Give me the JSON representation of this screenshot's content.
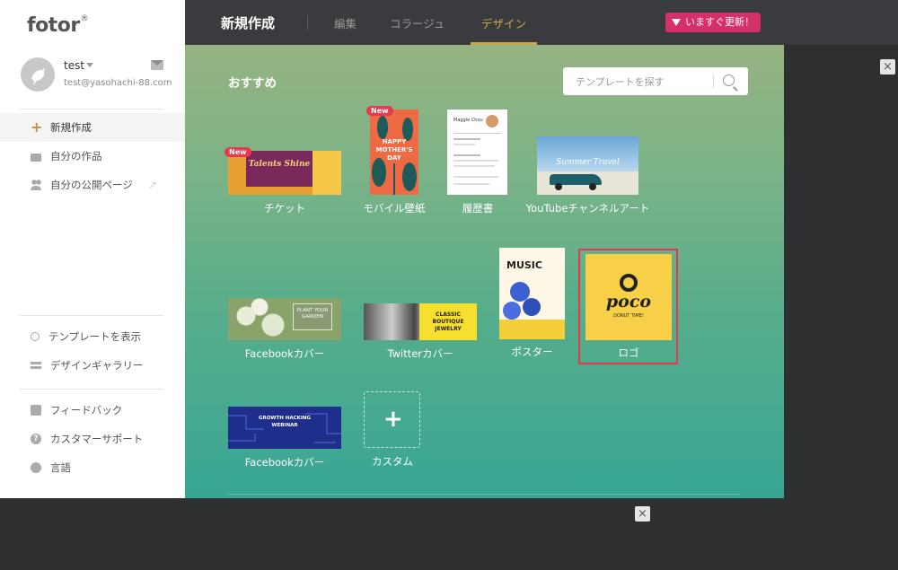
{
  "app": {
    "logo": "fotor"
  },
  "user": {
    "name": "test",
    "email": "test@yasohachi-88.com"
  },
  "sidebar": {
    "main_items": [
      {
        "label": "新規作成",
        "icon": "plus-icon"
      },
      {
        "label": "自分の作品",
        "icon": "folder-icon"
      },
      {
        "label": "自分の公開ページ",
        "icon": "people-icon"
      }
    ],
    "help_items": [
      {
        "label": "テンプレートを表示",
        "icon": "search-icon"
      },
      {
        "label": "デザインギャラリー",
        "icon": "layers-icon"
      }
    ],
    "support_items": [
      {
        "label": "フィードバック",
        "icon": "edit-icon"
      },
      {
        "label": "カスタマーサポート",
        "icon": "help-icon"
      },
      {
        "label": "言語",
        "icon": "globe-icon"
      }
    ]
  },
  "topbar": {
    "title": "新規作成",
    "tabs": [
      "編集",
      "コラージュ",
      "デザイン"
    ],
    "active_tab": "デザイン",
    "upgrade_label": "いますぐ更新！"
  },
  "main": {
    "section_title": "おすすめ",
    "search_placeholder": "テンプレートを探す",
    "new_badge": "New",
    "templates": [
      {
        "label": "チケット",
        "thumb_text": "Talents Shine"
      },
      {
        "label": "モバイル壁紙",
        "thumb_text": "HAPPY MOTHER'S DAY"
      },
      {
        "label": "履歴書",
        "thumb_text": "Maggie Chou"
      },
      {
        "label": "YouTubeチャンネルアート",
        "thumb_text": "Summer Travel"
      },
      {
        "label": "Facebookカバー",
        "thumb_text": "PLANT YOUR GARDEN"
      },
      {
        "label": "Twitterカバー",
        "thumb_text": "CLASSIC BOUTIQUE JEWELRY"
      },
      {
        "label": "ポスター",
        "thumb_text": "MUSIC"
      },
      {
        "label": "ロゴ",
        "thumb_text": "poco",
        "thumb_subtext": "DONUT TIME!"
      },
      {
        "label": "Facebookカバー",
        "thumb_text": "GROWTH HACKING WEBINAR"
      },
      {
        "label": "カスタム"
      }
    ],
    "selected_template": "ロゴ"
  },
  "colors": {
    "accent": "#c9a84c",
    "upgrade": "#d6306a",
    "selection": "#e8384f",
    "topbar": "#3a3b3e"
  }
}
